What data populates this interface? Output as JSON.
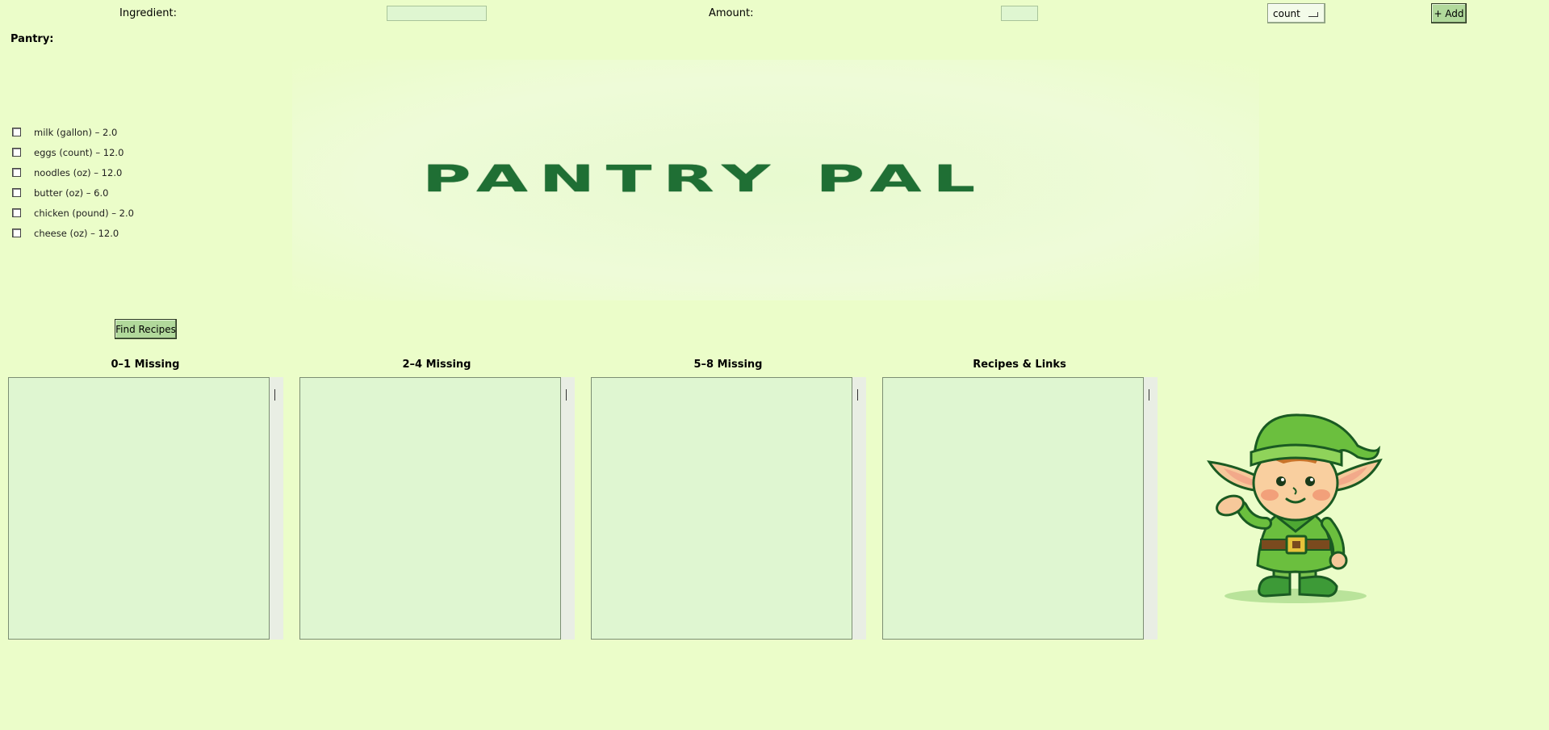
{
  "form": {
    "ingredient_label": "Ingredient:",
    "ingredient_value": "",
    "amount_label": "Amount:",
    "amount_value": "",
    "unit_selected": "count",
    "add_label": "+ Add"
  },
  "pantry": {
    "heading": "Pantry:",
    "items": [
      {
        "label": "milk (gallon) – 2.0",
        "checked": false
      },
      {
        "label": "eggs (count) – 12.0",
        "checked": false
      },
      {
        "label": "noodles (oz) – 12.0",
        "checked": false
      },
      {
        "label": "butter (oz) – 6.0",
        "checked": false
      },
      {
        "label": "chicken (pound) – 2.0",
        "checked": false
      },
      {
        "label": "cheese (oz) – 12.0",
        "checked": false
      }
    ]
  },
  "banner": {
    "title": "PANTRY PAL"
  },
  "actions": {
    "find_label": "Find Recipes"
  },
  "results": {
    "columns": [
      {
        "heading": "0–1 Missing",
        "items": []
      },
      {
        "heading": "2–4 Missing",
        "items": []
      },
      {
        "heading": "5–8 Missing",
        "items": []
      },
      {
        "heading": "Recipes & Links",
        "items": []
      }
    ]
  },
  "colors": {
    "background": "#ebfdc9",
    "accent": "#1f6f34",
    "button": "#b1d99b"
  },
  "mascot": {
    "icon": "elf-mascot-icon"
  }
}
